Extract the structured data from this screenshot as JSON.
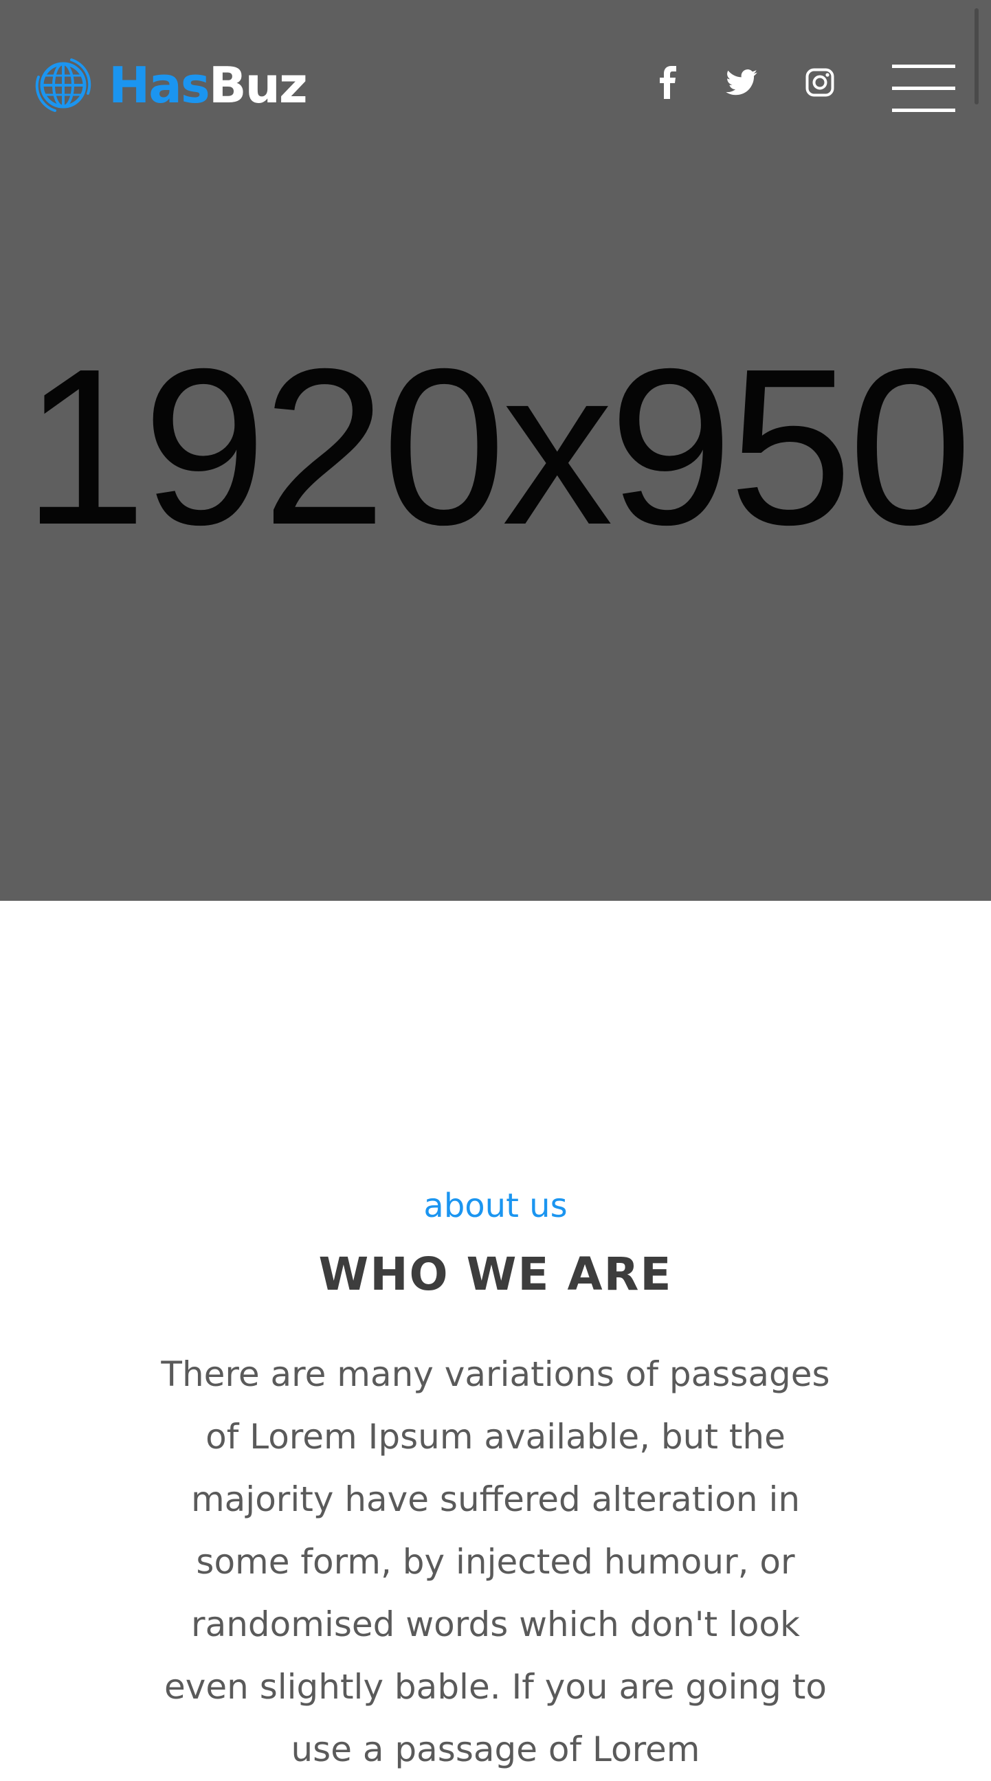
{
  "header": {
    "logo": {
      "part1": "Has",
      "part2": "Buz",
      "icon": "globe-icon"
    },
    "social_links": [
      {
        "name": "facebook",
        "icon": "facebook-icon"
      },
      {
        "name": "twitter",
        "icon": "twitter-icon"
      },
      {
        "name": "instagram",
        "icon": "instagram-icon"
      }
    ],
    "menu_icon": "hamburger-menu-icon"
  },
  "hero": {
    "placeholder_text": "1920x950",
    "background_color": "#5f5f5f"
  },
  "about": {
    "eyebrow": "about us",
    "title": "WHO WE ARE",
    "body": "There are many variations of passages of Lorem Ipsum available, but the majority have suffered alteration in some form, by injected humour, or randomised words which don't look even slightly bable. If you are going to use a passage of Lorem"
  },
  "colors": {
    "accent": "#1b95f0",
    "heading": "#3d3d3d",
    "body_text": "#5a5a5a"
  }
}
